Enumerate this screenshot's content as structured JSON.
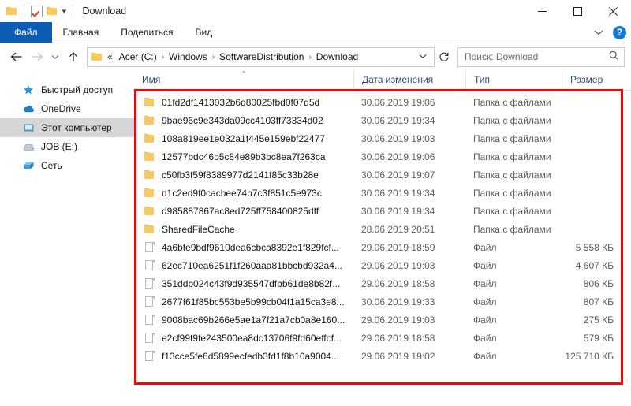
{
  "window": {
    "title": "Download",
    "quick_access": [
      {
        "name": "folder-icon",
        "label": "Проводник"
      },
      {
        "name": "properties-icon",
        "label": "Свойства"
      },
      {
        "name": "new-folder-icon",
        "label": "Создать папку"
      }
    ],
    "controls": {
      "minimize": "Свернуть",
      "maximize": "Развернуть",
      "close": "Закрыть"
    }
  },
  "ribbon": {
    "tabs": [
      {
        "label": "Файл",
        "active": true
      },
      {
        "label": "Главная",
        "active": false
      },
      {
        "label": "Поделиться",
        "active": false
      },
      {
        "label": "Вид",
        "active": false
      }
    ],
    "collapse_label": "Свернуть ленту",
    "help_label": "?"
  },
  "address": {
    "back": "Назад",
    "forward": "Вперед",
    "recent": "Последние расположения",
    "up": "Вверх",
    "crumb_lead": "«",
    "crumbs": [
      "Acer (C:)",
      "Windows",
      "SoftwareDistribution",
      "Download"
    ],
    "separator": "›",
    "dropdown": "Предыдущие расположения",
    "refresh": "Обновить"
  },
  "search": {
    "placeholder": "Поиск: Download",
    "value": ""
  },
  "sidebar": {
    "items": [
      {
        "label": "Быстрый доступ",
        "icon": "star-icon",
        "selected": false
      },
      {
        "label": "OneDrive",
        "icon": "cloud-icon",
        "selected": false
      },
      {
        "label": "Этот компьютер",
        "icon": "computer-icon",
        "selected": true
      },
      {
        "label": "JOB (E:)",
        "icon": "drive-icon",
        "selected": false
      },
      {
        "label": "Сеть",
        "icon": "network-icon",
        "selected": false
      }
    ]
  },
  "file_list": {
    "columns": [
      {
        "label": "Имя",
        "sorted": true,
        "sort_caret": "⌃"
      },
      {
        "label": "Дата изменения",
        "sorted": false
      },
      {
        "label": "Тип",
        "sorted": false
      },
      {
        "label": "Размер",
        "sorted": false
      }
    ],
    "rows": [
      {
        "icon": "folder-icon",
        "name": "01fd2df1413032b6d80025fbd0f07d5d",
        "date": "30.06.2019 19:06",
        "type": "Папка с файлами",
        "size": ""
      },
      {
        "icon": "folder-icon",
        "name": "9bae96c9e343da09cc4103ff73334d02",
        "date": "30.06.2019 19:34",
        "type": "Папка с файлами",
        "size": ""
      },
      {
        "icon": "folder-icon",
        "name": "108a819ee1e032a1f445e159ebf22477",
        "date": "30.06.2019 19:03",
        "type": "Папка с файлами",
        "size": ""
      },
      {
        "icon": "folder-icon",
        "name": "12577bdc46b5c84e89b3bc8ea7f263ca",
        "date": "30.06.2019 19:06",
        "type": "Папка с файлами",
        "size": ""
      },
      {
        "icon": "folder-icon",
        "name": "c50fb3f59f8389977d2141f85c33b28e",
        "date": "30.06.2019 19:07",
        "type": "Папка с файлами",
        "size": ""
      },
      {
        "icon": "folder-icon",
        "name": "d1c2ed9f0cacbee74b7c3f851c5e973c",
        "date": "30.06.2019 19:34",
        "type": "Папка с файлами",
        "size": ""
      },
      {
        "icon": "folder-icon",
        "name": "d985887867ac8ed725ff758400825dff",
        "date": "30.06.2019 19:34",
        "type": "Папка с файлами",
        "size": ""
      },
      {
        "icon": "folder-icon",
        "name": "SharedFileCache",
        "date": "28.06.2019 20:51",
        "type": "Папка с файлами",
        "size": ""
      },
      {
        "icon": "file-icon",
        "name": "4a6bfe9bdf9610dea6cbca8392e1f829fcf...",
        "date": "29.06.2019 18:59",
        "type": "Файл",
        "size": "5 558 КБ"
      },
      {
        "icon": "file-icon",
        "name": "62ec710ea6251f1f260aaa81bbcbd932a4...",
        "date": "29.06.2019 19:03",
        "type": "Файл",
        "size": "4 607 КБ"
      },
      {
        "icon": "file-icon",
        "name": "351ddb024c43f9d935547dfbb61de8b82f...",
        "date": "29.06.2019 18:58",
        "type": "Файл",
        "size": "806 КБ"
      },
      {
        "icon": "file-icon",
        "name": "2677f61f85bc553be5b99cb04f1a15ca3e8...",
        "date": "30.06.2019 19:33",
        "type": "Файл",
        "size": "807 КБ"
      },
      {
        "icon": "file-icon",
        "name": "9008bac69b266e5ae1a7f21a7cb0a8e160...",
        "date": "29.06.2019 19:03",
        "type": "Файл",
        "size": "275 КБ"
      },
      {
        "icon": "file-icon",
        "name": "e2cf99f9fe243500ea8dc13706f9fd60effcf...",
        "date": "29.06.2019 18:58",
        "type": "Файл",
        "size": "579 КБ"
      },
      {
        "icon": "file-icon",
        "name": "f13cce5fe6d5899ecfedb3fd1f8b10a9004...",
        "date": "29.06.2019 19:02",
        "type": "Файл",
        "size": "125 710 КБ"
      }
    ]
  },
  "annotation": {
    "color": "#fe0000",
    "shape": "rectangle"
  }
}
